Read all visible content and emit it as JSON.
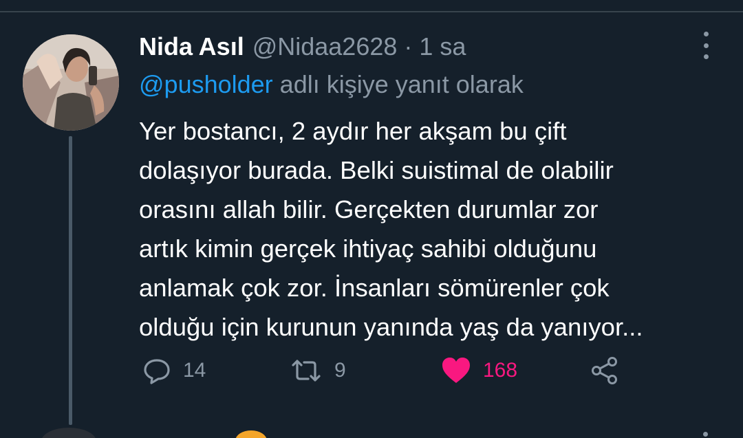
{
  "tweet": {
    "author_name": "Nida Asıl",
    "author_handle": "@Nidaa2628",
    "separator": "·",
    "time": "1 sa",
    "reply_mention": "@pusholder",
    "reply_suffix": " adlı kişiye yanıt olarak",
    "text": "Yer bostancı, 2 aydır her akşam bu çift\ndolaşıyor burada. Belki suistimal de olabilir\norasını allah bilir. Gerçekten durumlar zor\nartık kimin gerçek ihtiyaç sahibi olduğunu\nanlamak çok zor. İnsanları sömürenler çok\nolduğu için kurunun yanında yaş da yanıyor...",
    "actions": {
      "replies": "14",
      "retweets": "9",
      "likes": "168"
    }
  },
  "icons": {
    "more": "more-vertical-icon",
    "reply": "reply-icon",
    "retweet": "retweet-icon",
    "like": "heart-icon",
    "share": "share-icon"
  },
  "colors": {
    "background": "#15202b",
    "mention": "#1d9bf0",
    "secondary_text": "#8b98a5",
    "like": "#f91880",
    "divider": "#38444d"
  }
}
